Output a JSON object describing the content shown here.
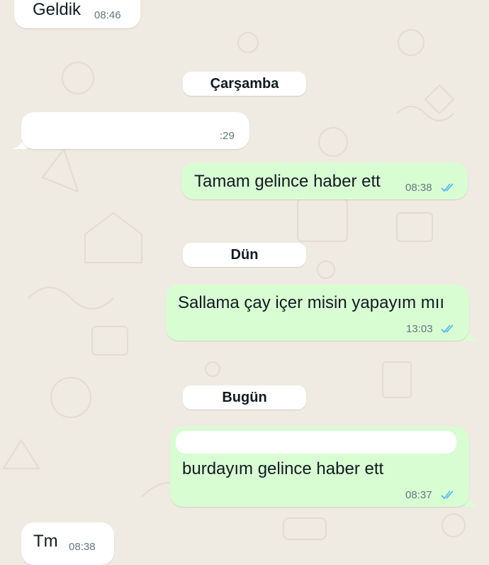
{
  "colors": {
    "chat_background": "#efeae2",
    "incoming_bubble": "#ffffff",
    "outgoing_bubble": "#d9fdd3",
    "read_ticks": "#53bdeb",
    "timestamp": "#667781"
  },
  "messages": [
    {
      "direction": "incoming",
      "text": "Geldik",
      "time": "08:46"
    },
    {
      "direction": "incoming",
      "text": "",
      "time": ":29",
      "redacted": true
    },
    {
      "direction": "outgoing",
      "text": "Tamam gelince haber ett",
      "time": "08:38",
      "status": "read-double-check-icon"
    },
    {
      "direction": "outgoing",
      "text": "Sallama çay içer misin yapayım mıı",
      "time": "13:03",
      "status": "read-double-check-icon"
    },
    {
      "direction": "outgoing",
      "text": "burdayım gelince haber ett",
      "time": "08:37",
      "status": "read-double-check-icon",
      "redacted_quote": true
    },
    {
      "direction": "incoming",
      "text": "Tm",
      "time": "08:38"
    }
  ],
  "day_separators": [
    "Çarşamba",
    "Dün",
    "Bugün"
  ]
}
